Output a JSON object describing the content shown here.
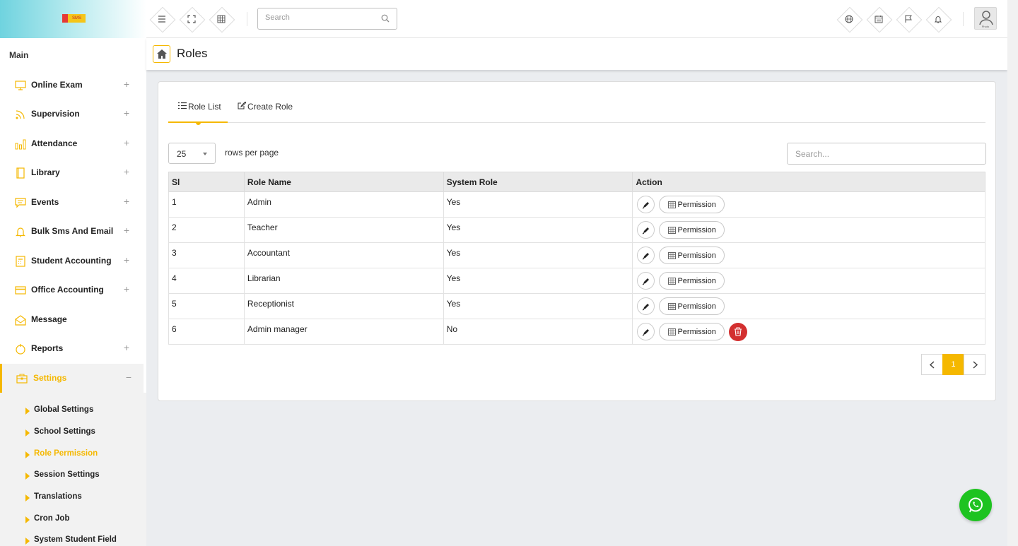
{
  "topbar": {
    "logo_text": "SMS",
    "search_placeholder": "Search",
    "avatar_label": "Photo"
  },
  "sidebar": {
    "heading": "Main",
    "items": [
      {
        "label": "Online Exam",
        "toggle": "+"
      },
      {
        "label": "Supervision",
        "toggle": "+"
      },
      {
        "label": "Attendance",
        "toggle": "+"
      },
      {
        "label": "Library",
        "toggle": "+"
      },
      {
        "label": "Events",
        "toggle": "+"
      },
      {
        "label": "Bulk Sms And Email",
        "toggle": "+"
      },
      {
        "label": "Student Accounting",
        "toggle": "+"
      },
      {
        "label": "Office Accounting",
        "toggle": "+"
      },
      {
        "label": "Message",
        "toggle": ""
      },
      {
        "label": "Reports",
        "toggle": "+"
      },
      {
        "label": "Settings",
        "toggle": "−"
      }
    ],
    "subitems": [
      {
        "label": "Global Settings"
      },
      {
        "label": "School Settings"
      },
      {
        "label": "Role Permission"
      },
      {
        "label": "Session Settings"
      },
      {
        "label": "Translations"
      },
      {
        "label": "Cron Job"
      },
      {
        "label": "System Student Field"
      }
    ]
  },
  "page": {
    "title": "Roles"
  },
  "tabs": {
    "list": "Role List",
    "create": "Create Role"
  },
  "table_controls": {
    "rows_per_page": "25",
    "rows_label": "rows per page",
    "search_placeholder": "Search..."
  },
  "table": {
    "headers": [
      "Sl",
      "Role Name",
      "System Role",
      "Action"
    ],
    "permission_label": "Permission",
    "rows": [
      {
        "sl": "1",
        "name": "Admin",
        "system": "Yes"
      },
      {
        "sl": "2",
        "name": "Teacher",
        "system": "Yes"
      },
      {
        "sl": "3",
        "name": "Accountant",
        "system": "Yes"
      },
      {
        "sl": "4",
        "name": "Librarian",
        "system": "Yes"
      },
      {
        "sl": "5",
        "name": "Receptionist",
        "system": "Yes"
      },
      {
        "sl": "6",
        "name": "Admin manager",
        "system": "No"
      }
    ]
  },
  "pagination": {
    "current": "1"
  },
  "colors": {
    "accent": "#f5b800",
    "danger": "#d32f2f",
    "whatsapp": "#1ec320"
  }
}
